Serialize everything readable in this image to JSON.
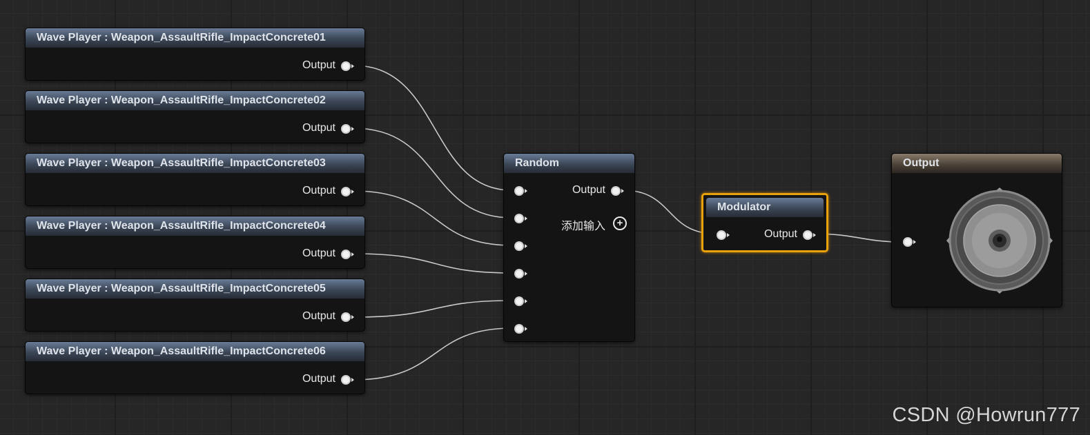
{
  "wave_players": [
    {
      "title": "Wave Player : Weapon_AssaultRifle_ImpactConcrete01",
      "output_label": "Output"
    },
    {
      "title": "Wave Player : Weapon_AssaultRifle_ImpactConcrete02",
      "output_label": "Output"
    },
    {
      "title": "Wave Player : Weapon_AssaultRifle_ImpactConcrete03",
      "output_label": "Output"
    },
    {
      "title": "Wave Player : Weapon_AssaultRifle_ImpactConcrete04",
      "output_label": "Output"
    },
    {
      "title": "Wave Player : Weapon_AssaultRifle_ImpactConcrete05",
      "output_label": "Output"
    },
    {
      "title": "Wave Player : Weapon_AssaultRifle_ImpactConcrete06",
      "output_label": "Output"
    }
  ],
  "random_node": {
    "title": "Random",
    "output_label": "Output",
    "add_input_label": "添加输入"
  },
  "modulator_node": {
    "title": "Modulator",
    "output_label": "Output"
  },
  "output_node": {
    "title": "Output",
    "icon": "speaker-icon"
  },
  "watermark": "CSDN @Howrun777",
  "colors": {
    "selection": "#e9a10c",
    "node_header": "#3b4656",
    "wire": "#cfcfcf"
  }
}
